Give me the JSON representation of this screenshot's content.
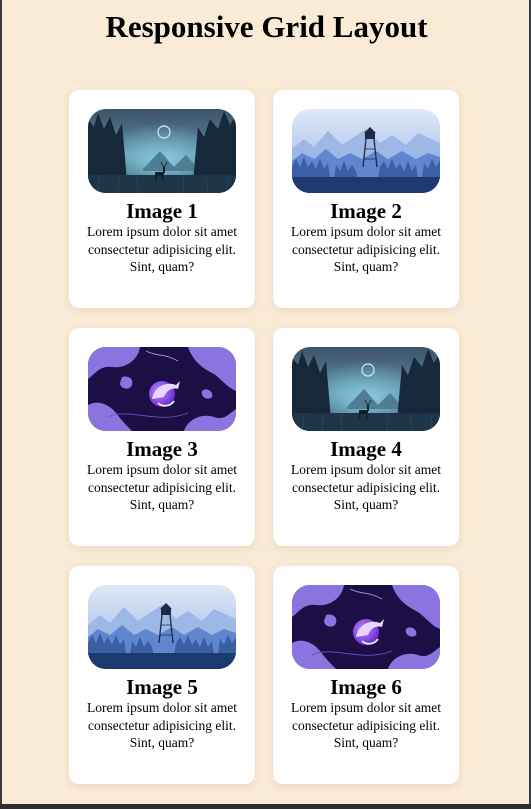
{
  "page": {
    "title": "Responsive Grid Layout"
  },
  "cards": [
    {
      "title": "Image 1",
      "text": "Lorem ipsum dolor sit amet consectetur adipisicing elit. Sint, quam?",
      "image": "night-forest-deer"
    },
    {
      "title": "Image 2",
      "text": "Lorem ipsum dolor sit amet consectetur adipisicing elit. Sint, quam?",
      "image": "blue-forest-watchtower"
    },
    {
      "title": "Image 3",
      "text": "Lorem ipsum dolor sit amet consectetur adipisicing elit. Sint, quam?",
      "image": "purple-abstract-fox"
    },
    {
      "title": "Image 4",
      "text": "Lorem ipsum dolor sit amet consectetur adipisicing elit. Sint, quam?",
      "image": "night-forest-deer"
    },
    {
      "title": "Image 5",
      "text": "Lorem ipsum dolor sit amet consectetur adipisicing elit. Sint, quam?",
      "image": "blue-forest-watchtower"
    },
    {
      "title": "Image 6",
      "text": "Lorem ipsum dolor sit amet consectetur adipisicing elit. Sint, quam?",
      "image": "purple-abstract-fox"
    }
  ],
  "colors": {
    "background": "#faebd7",
    "card": "#ffffff",
    "accent_purple": "#8b6fe0"
  }
}
